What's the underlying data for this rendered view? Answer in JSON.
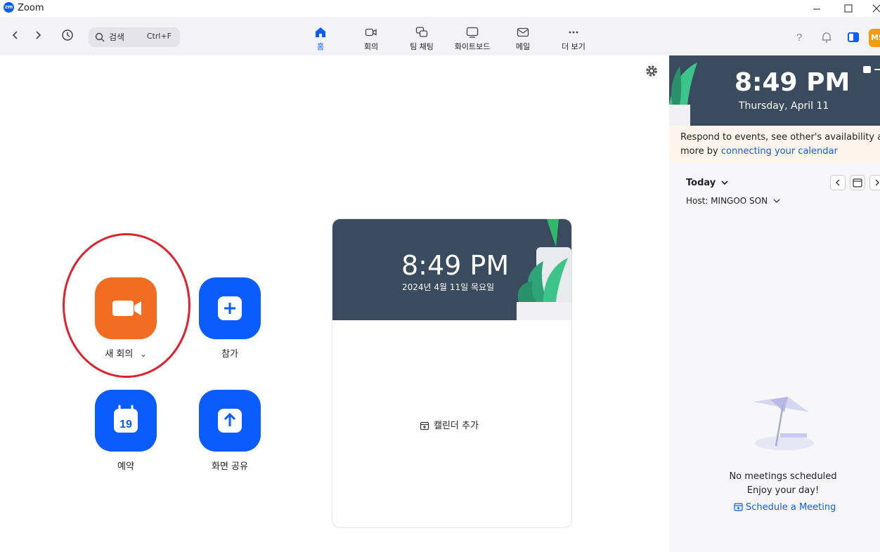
{
  "window": {
    "title": "Zoom",
    "logo_text": "zm"
  },
  "toolbar": {
    "search_placeholder": "검색",
    "search_shortcut": "Ctrl+F",
    "tabs": [
      {
        "label": "홈",
        "icon": "home-icon",
        "active": true
      },
      {
        "label": "회의",
        "icon": "video-icon",
        "active": false
      },
      {
        "label": "팀 채팅",
        "icon": "chat-icon",
        "active": false
      },
      {
        "label": "화이트보드",
        "icon": "whiteboard-icon",
        "active": false
      },
      {
        "label": "메일",
        "icon": "mail-icon",
        "active": false
      },
      {
        "label": "더 보기",
        "icon": "more-icon",
        "active": false
      }
    ],
    "avatar_initials": "MS"
  },
  "actions": {
    "new_meeting": "새 회의",
    "new_meeting_caret": "⌄",
    "join": "참가",
    "schedule": "예약",
    "schedule_day": "19",
    "share_screen": "화면 공유"
  },
  "card": {
    "time": "8:49 PM",
    "date": "2024년 4월 11일 목요일",
    "add_calendar": "캘린더 추가"
  },
  "right_panel": {
    "time": "8:49 PM",
    "date": "Thursday, April 11",
    "notice_prefix": "Respond to events, see other's availability and",
    "notice_more": "more by ",
    "notice_link": "connecting your calendar",
    "today_label": "Today",
    "host_label": "Host: MINGOO SON",
    "empty_title": "No meetings scheduled",
    "empty_sub": "Enjoy your day!",
    "schedule_link": "Schedule a Meeting"
  },
  "colors": {
    "accent": "#0b5cff",
    "orange": "#f26d21",
    "hero": "#3a4a5f",
    "annotation": "#e0202c"
  }
}
